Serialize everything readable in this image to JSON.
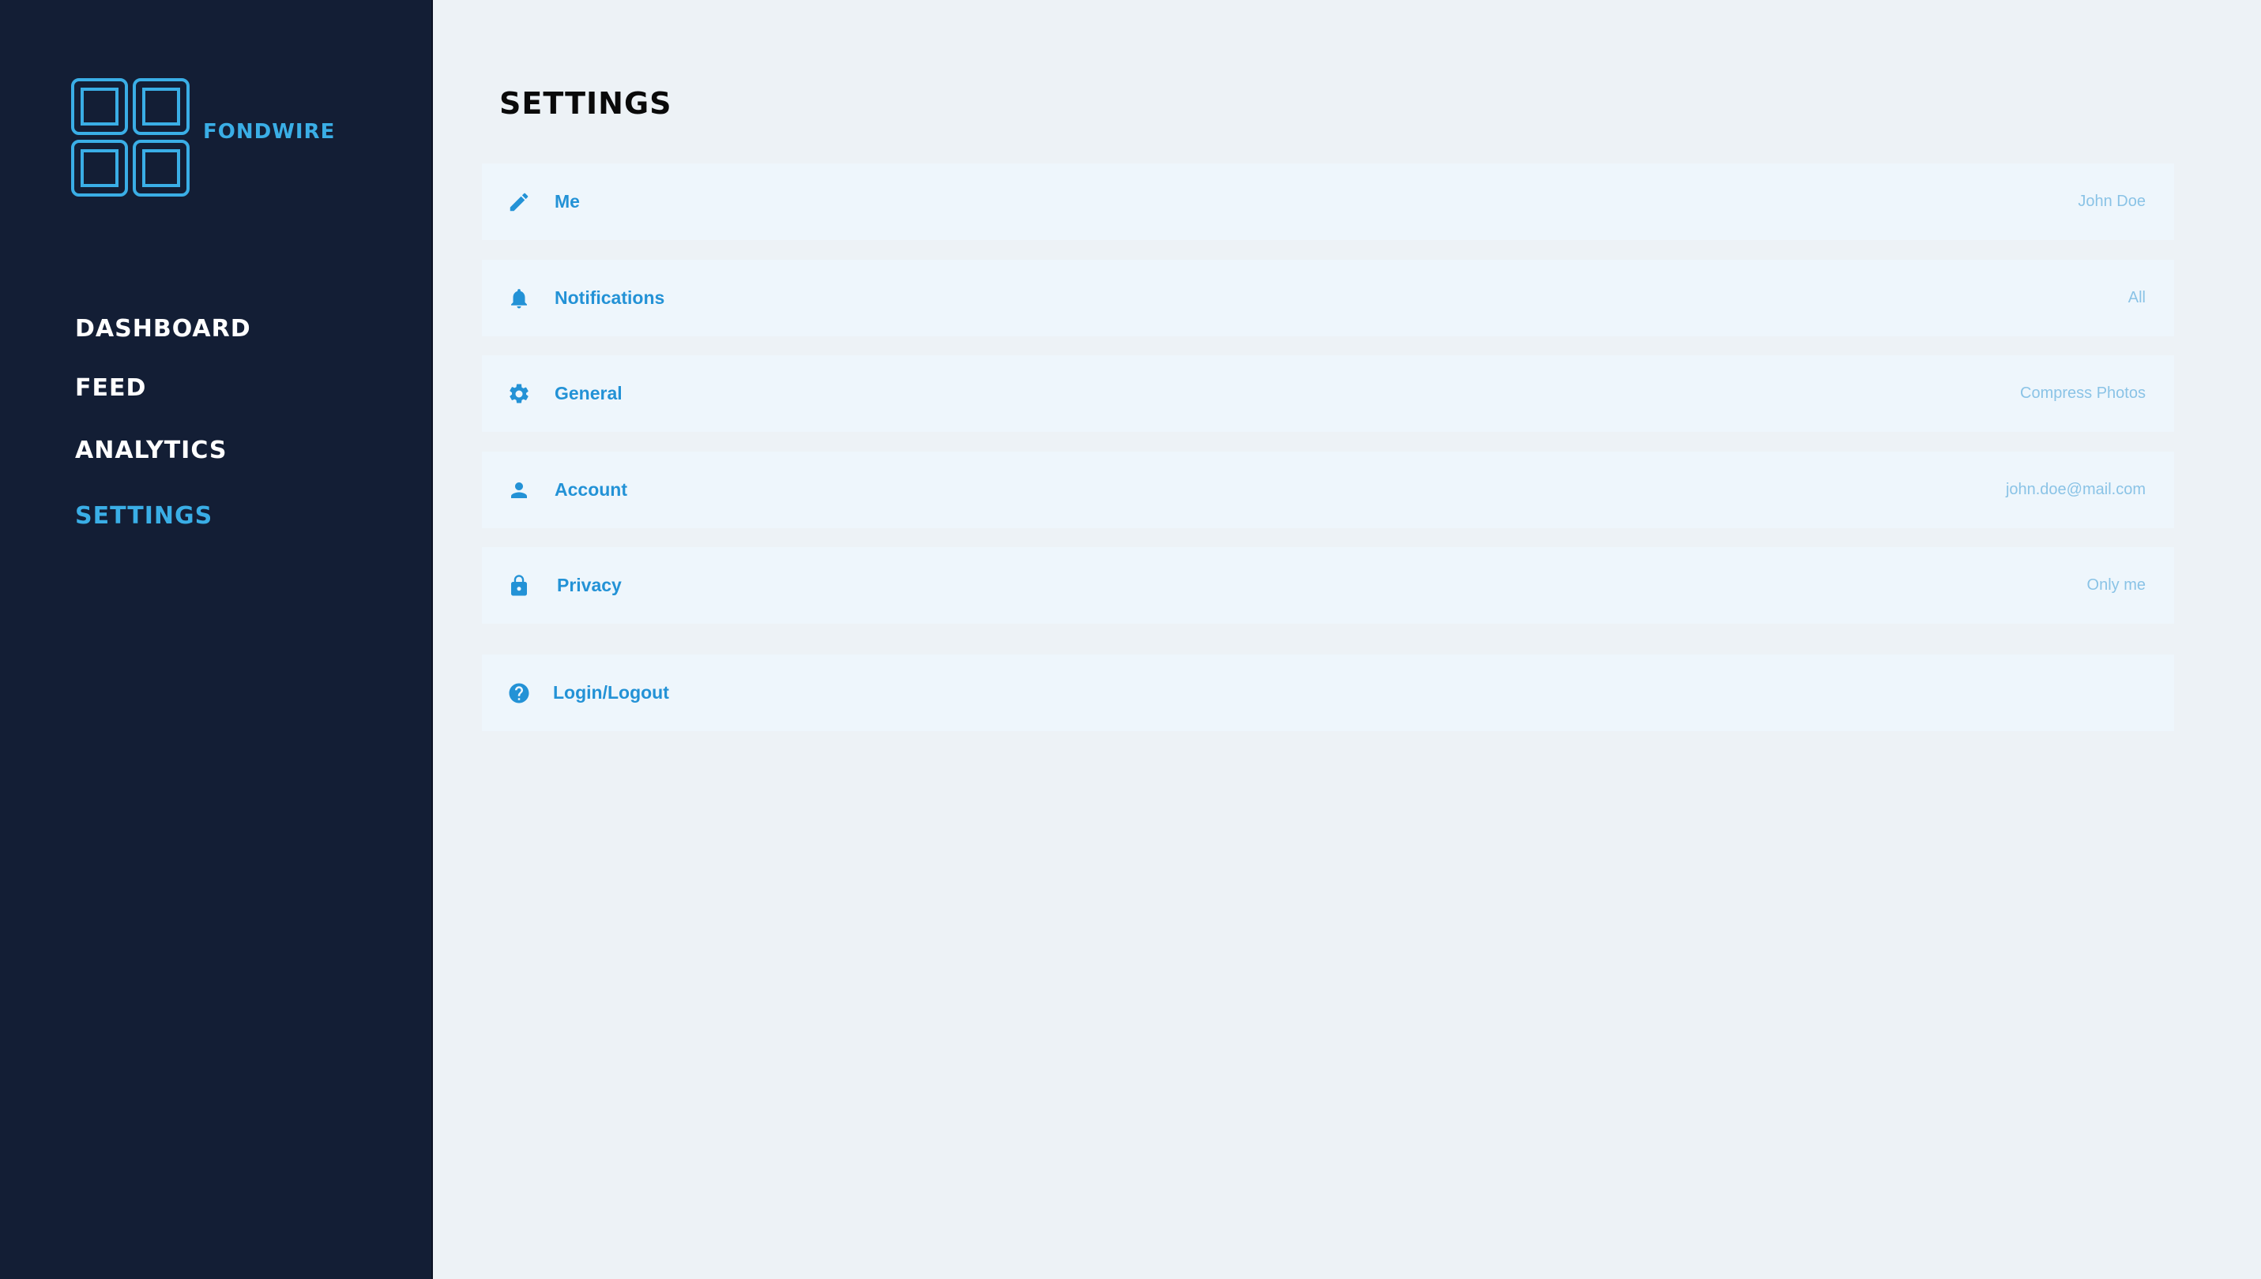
{
  "app": {
    "brand": "FONDWIRE"
  },
  "sidebar": {
    "items": [
      {
        "label": "DASHBOARD",
        "active": false
      },
      {
        "label": "FEED",
        "active": false
      },
      {
        "label": "ANALYTICS",
        "active": false
      },
      {
        "label": "SETTINGS",
        "active": true
      }
    ]
  },
  "main": {
    "title": "SETTINGS",
    "rows": [
      {
        "icon": "pencil-icon",
        "label": "Me",
        "value": "John Doe"
      },
      {
        "icon": "bell-icon",
        "label": "Notifications",
        "value": "All"
      },
      {
        "icon": "gear-icon",
        "label": "General",
        "value": "Compress Photos"
      },
      {
        "icon": "user-icon",
        "label": "Account",
        "value": "john.doe@mail.com"
      },
      {
        "icon": "lock-icon",
        "label": "Privacy",
        "value": "Only me"
      },
      {
        "icon": "question-icon",
        "label": "Login/Logout",
        "value": ""
      }
    ]
  },
  "colors": {
    "sidebar_bg": "#131e35",
    "accent": "#3aaee6",
    "row_label": "#2392d6",
    "row_value": "#8ac3e6",
    "page_bg": "#edf2f6"
  }
}
